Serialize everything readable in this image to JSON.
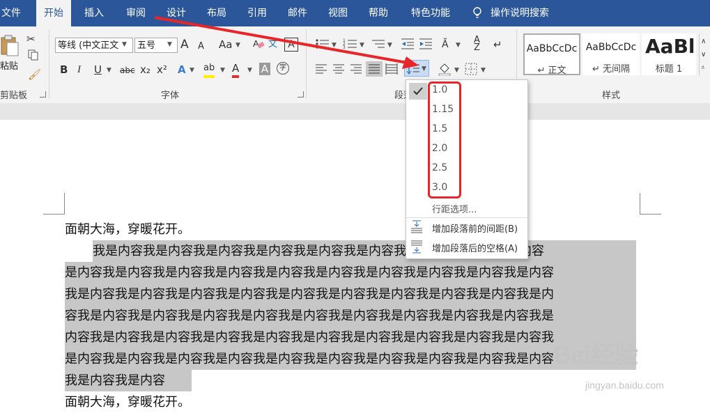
{
  "tabs": [
    "文件",
    "开始",
    "插入",
    "审阅",
    "设计",
    "布局",
    "引用",
    "邮件",
    "视图",
    "帮助",
    "特色功能",
    "操作说明搜索"
  ],
  "clipboard": {
    "paste_label": "粘贴",
    "group_label": "剪贴板"
  },
  "font": {
    "font_name": "等线 (中文正文",
    "font_size": "五号",
    "grow": "A",
    "shrink": "A",
    "case": "Aa",
    "phonetic": "文",
    "border_char": "A",
    "bold": "B",
    "italic": "I",
    "underline": "U",
    "strike": "abc",
    "subscript": "x₂",
    "superscript": "x²",
    "effects": "A",
    "highlight": "ab",
    "color": "A",
    "shading": "A",
    "enclose": "字",
    "group_label": "字体"
  },
  "paragraph": {
    "group_label": "段落"
  },
  "styles": {
    "items": [
      {
        "sample": "AaBbCcDc",
        "name": "↵ 正文"
      },
      {
        "sample": "AaBbCcDc",
        "name": "↵ 无间隔"
      },
      {
        "sample": "AaBl",
        "name": "标题 1"
      }
    ],
    "group_label": "样式"
  },
  "line_spacing_menu": {
    "options": [
      "1.0",
      "1.15",
      "1.5",
      "2.0",
      "2.5",
      "3.0"
    ],
    "selected": "1.0",
    "options_link": "行距选项...",
    "add_before": "增加段落前的间距(B)",
    "add_after": "增加段落后的空格(A)"
  },
  "colors": {
    "ribbon_blue": "#2b579a",
    "highlight_box": "#e8262a",
    "text_red": "#e03030",
    "selection_grey": "#c7c7c7"
  },
  "document": {
    "title_line": "面朝大海，穿暖花开。",
    "lines": [
      "我是内容我是内容我是内容我是内容我是内容我是内容我是内容我是内容我是内容",
      "是内容我是内容我是内容我是内容我是内容我是内容我是内容我是内容我是内容我是内容",
      "我是内容我是内容我是内容我是内容我是内容我是内容我是内容我是内容我是内容我是内",
      "容我是内容我是内容我是内容我是内容我是内容我是内容我是内容我是内容我是内容我是",
      "内容我是内容我是内容我是内容我是内容我是内容我是内容我是内容我是内容我是内容我",
      "是内容我是内容我是内容我是内容我是内容我是内容我是内容我是内容我是内容我是内容",
      "我是内容我是内容"
    ],
    "last_line": "面朝大海，穿暖花开。"
  },
  "watermark": {
    "brand": "Bai经验",
    "url": "jingyan.baidu.com"
  }
}
